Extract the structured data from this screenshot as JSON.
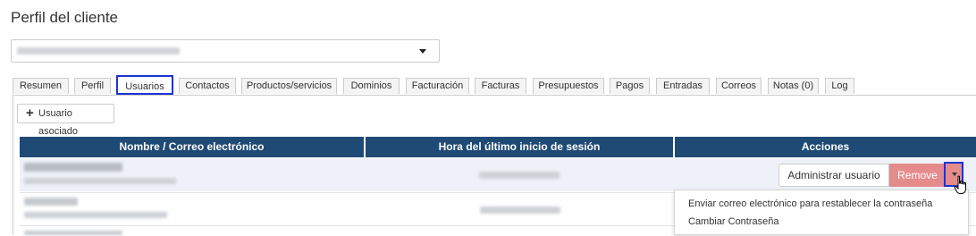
{
  "page": {
    "title": "Perfil del cliente"
  },
  "client_select": {
    "value": ""
  },
  "tabs": [
    {
      "label": "Resumen"
    },
    {
      "label": "Perfil"
    },
    {
      "label": "Usuarios"
    },
    {
      "label": "Contactos"
    },
    {
      "label": "Productos/servicios"
    },
    {
      "label": "Dominios"
    },
    {
      "label": "Facturación"
    },
    {
      "label": "Facturas"
    },
    {
      "label": "Presupuestos"
    },
    {
      "label": "Pagos"
    },
    {
      "label": "Entradas"
    },
    {
      "label": "Correos"
    },
    {
      "label": "Notas (0)"
    },
    {
      "label": "Log"
    }
  ],
  "active_tab": "Usuarios",
  "toolbar": {
    "add_user_label": "Usuario asociado"
  },
  "table": {
    "headers": [
      "Nombre / Correo electrónico",
      "Hora del último inicio de sesión",
      "Acciones"
    ]
  },
  "actions": {
    "admin_label": "Administrar usuario",
    "remove_label": "Remove"
  },
  "dropdown": {
    "items": [
      "Enviar correo electrónico para restablecer la contraseña",
      "Cambiar Contraseña"
    ]
  },
  "colors": {
    "header_bg": "#204a76",
    "remove_bg": "#e58b8b",
    "highlight": "#1d34d1"
  }
}
